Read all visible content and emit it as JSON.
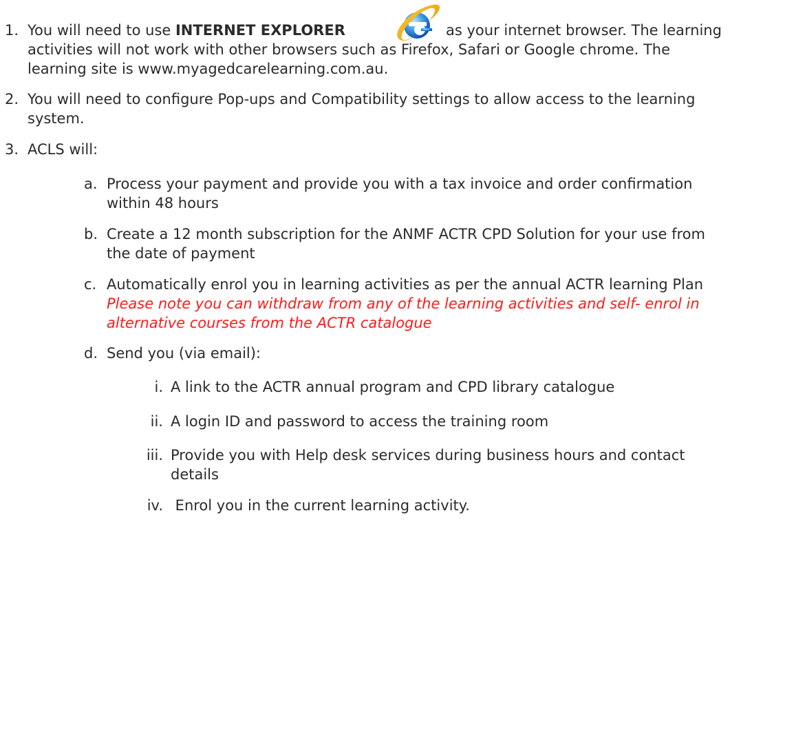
{
  "items": [
    {
      "number": "1.",
      "line1_prefix": "You will need to use ",
      "line1_bold": "INTERNET EXPLORER",
      "line1_suffix": "as your internet browser. The learning",
      "line2": "activities will not work with other browsers such as Firefox, Safari or Google chrome. The",
      "line3": "learning site is www.myagedcarelearning.com.au.",
      "icon": "internet-explorer-logo",
      "icon_colors": {
        "blue": "#1e73d8",
        "light_blue": "#7cc4ff",
        "ring": "#f2b21c",
        "ring_dark": "#e08a00"
      }
    },
    {
      "number": "2.",
      "line1": "You will need to configure Pop-ups and Compatibility settings to allow access to the learning",
      "line2": "system."
    },
    {
      "number": "3.",
      "line1": "ACLS will:"
    }
  ],
  "sub_items": [
    {
      "letter": "a.",
      "line1": "Process your payment and provide you with a tax invoice and order confirmation",
      "line2": "within 48 hours"
    },
    {
      "letter": "b.",
      "line1": "Create a 12 month subscription for the ANMF ACTR CPD Solution for your use from",
      "line2": "the date of payment"
    },
    {
      "letter": "c.",
      "line1": "Automatically enrol you in learning activities as per the annual ACTR learning Plan",
      "note_line1": "Please note you can withdraw from any of the learning activities and self- enrol in",
      "note_line2": "alternative courses from the ACTR catalogue",
      "note_color": "#ff1a1a"
    },
    {
      "letter": "d.",
      "line1": "Send you (via email):"
    }
  ],
  "roman_items": [
    {
      "numeral": "i.",
      "line1": "A link to the ACTR annual program and CPD library catalogue"
    },
    {
      "numeral": "ii.",
      "line1": "A login ID and password to access the training room"
    },
    {
      "numeral": "iii.",
      "line1": "Provide you with Help desk services during business hours and contact",
      "line2": "details"
    },
    {
      "numeral": "iv.",
      "line1": " Enrol you in the current learning activity."
    }
  ]
}
